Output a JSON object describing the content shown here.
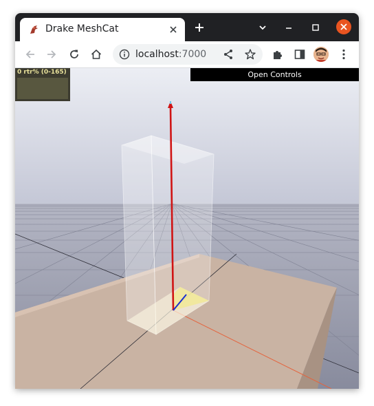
{
  "browser": {
    "tab_title": "Drake MeshCat",
    "url_host": "localhost",
    "url_port": ":7000"
  },
  "meshcat": {
    "stats_label": "0 rtr% (0-165)",
    "open_controls_label": "Open Controls"
  }
}
